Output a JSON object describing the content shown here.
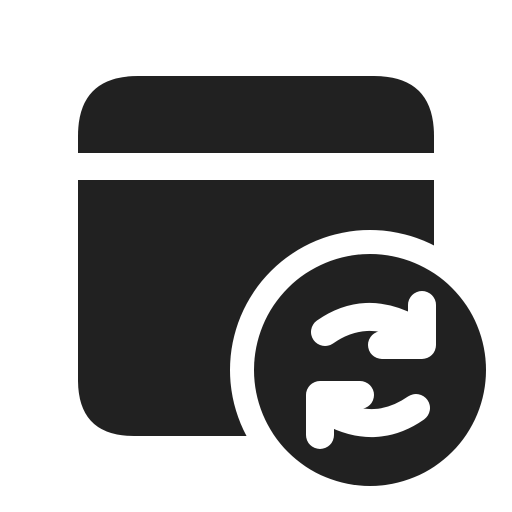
{
  "icon": {
    "name": "window-sync-icon",
    "fill_color": "#212121",
    "background_color": "#ffffff"
  }
}
